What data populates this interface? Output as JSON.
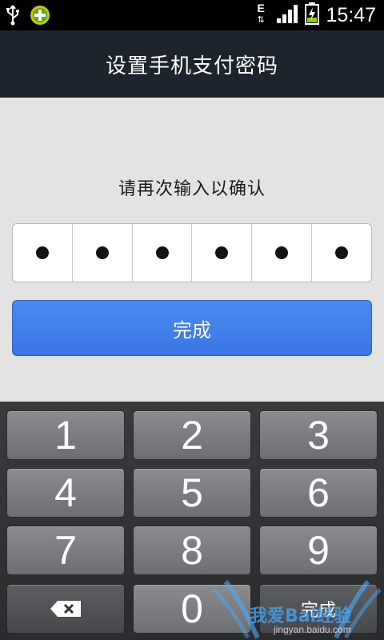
{
  "status_bar": {
    "time": "15:47",
    "network_type": "E",
    "icons": [
      "usb-icon",
      "app-notification-icon",
      "network-type-icon",
      "signal-icon",
      "battery-charging-icon"
    ]
  },
  "header": {
    "title": "设置手机支付密码"
  },
  "main": {
    "prompt": "请再次输入以确认",
    "pin_length": 6,
    "pin_filled": 6,
    "done_label": "完成"
  },
  "keypad": {
    "keys": [
      "1",
      "2",
      "3",
      "4",
      "5",
      "6",
      "7",
      "8",
      "9",
      "0"
    ],
    "done_label": "完成",
    "backspace_icon": "backspace-icon"
  },
  "watermark": {
    "text": "我爱Bai经验",
    "url": "jingyan.baidu.com"
  },
  "colors": {
    "title_bar": "#1e242e",
    "content_bg": "#e3e3e3",
    "primary_button": "#3a76e4",
    "keypad_bg": "#2a2b2d",
    "key_bg": "#7a7c7f"
  }
}
